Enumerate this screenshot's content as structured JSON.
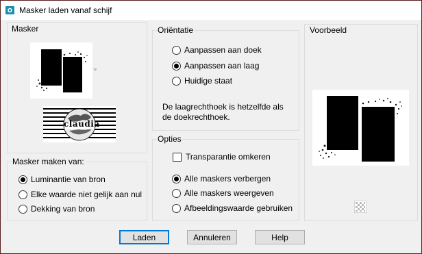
{
  "window": {
    "title": "Masker laden vanaf schijf"
  },
  "masker_group": {
    "label": "Masker",
    "logo_text": "claudia"
  },
  "source_group": {
    "label": "Masker maken van:",
    "options": [
      {
        "label": "Luminantie van bron",
        "selected": true
      },
      {
        "label": "Elke waarde niet gelijk aan nul",
        "selected": false
      },
      {
        "label": "Dekking van bron",
        "selected": false
      }
    ]
  },
  "orientation_group": {
    "label": "Oriëntatie",
    "options": [
      {
        "label": "Aanpassen aan doek",
        "selected": false
      },
      {
        "label": "Aanpassen aan laag",
        "selected": true
      },
      {
        "label": "Huidige staat",
        "selected": false
      }
    ],
    "note_line1": "De laagrechthoek is hetzelfde als",
    "note_line2": "de doekrechthoek."
  },
  "options_group": {
    "label": "Opties",
    "invert": {
      "label": "Transparantie omkeren",
      "checked": false
    },
    "options": [
      {
        "label": "Alle maskers verbergen",
        "selected": true
      },
      {
        "label": "Alle maskers weergeven",
        "selected": false
      },
      {
        "label": "Afbeeldingswaarde gebruiken",
        "selected": false
      }
    ]
  },
  "preview_group": {
    "label": "Voorbeeld"
  },
  "buttons": {
    "load": "Laden",
    "cancel": "Annuleren",
    "help": "Help"
  },
  "colors": {
    "accent": "#0078d7",
    "frame": "#3a0f0f",
    "background": "#f0f0f0"
  }
}
